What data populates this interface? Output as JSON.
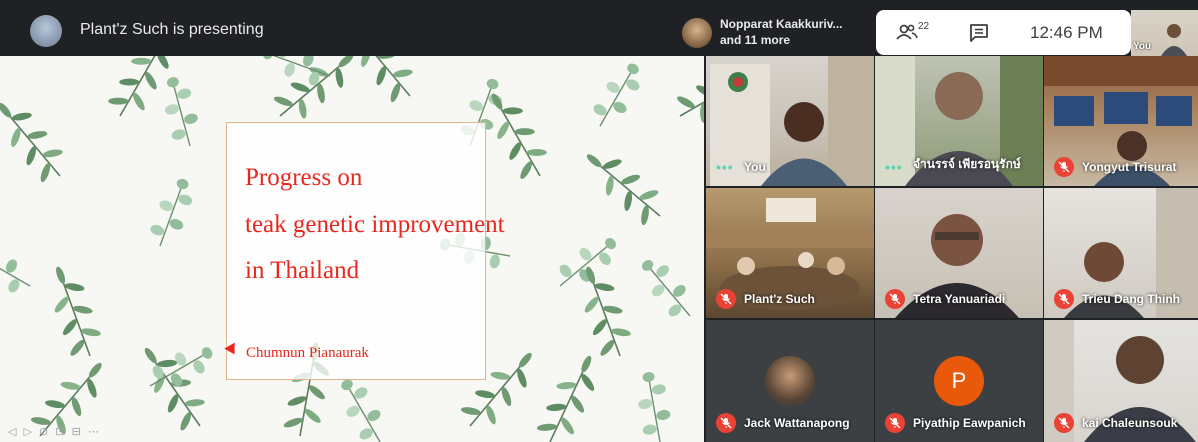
{
  "topbar": {
    "presenting_text": "Plant'z Such is presenting",
    "participants_line1": "Nopparat Kaakkuriv...",
    "participants_line2": "and 11 more",
    "people_count": "22",
    "time": "12:46 PM",
    "self_label": "You"
  },
  "slide": {
    "title_lines": [
      "Progress on",
      "teak genetic improvement",
      "in Thailand"
    ],
    "author": "Chumnun  Pianaurak",
    "controls": "◁ ▷ ⊘ ⊡ ⊟ ⋯"
  },
  "participants": [
    {
      "name": "You",
      "muted": false,
      "speaking": true
    },
    {
      "name": "จำนรรจ์ เพียรอนุรักษ์",
      "muted": false,
      "speaking": true
    },
    {
      "name": "Yongyut Trisurat",
      "muted": true
    },
    {
      "name": "Plant'z Such",
      "muted": true
    },
    {
      "name": "Tetra Yanuariadi",
      "muted": true
    },
    {
      "name": "Trieu Dang Thinh",
      "muted": true
    },
    {
      "name": "Jack Wattanapong",
      "muted": true
    },
    {
      "name": "Piyathip Eawpanich",
      "muted": true,
      "avatar_letter": "P"
    },
    {
      "name": "kai Chaleunsouk",
      "muted": true
    }
  ],
  "colors": {
    "mute_red": "#ea4335",
    "slide_text_red": "#e8281e",
    "avatar_orange": "#e8590c",
    "dark_bg": "#202124"
  }
}
